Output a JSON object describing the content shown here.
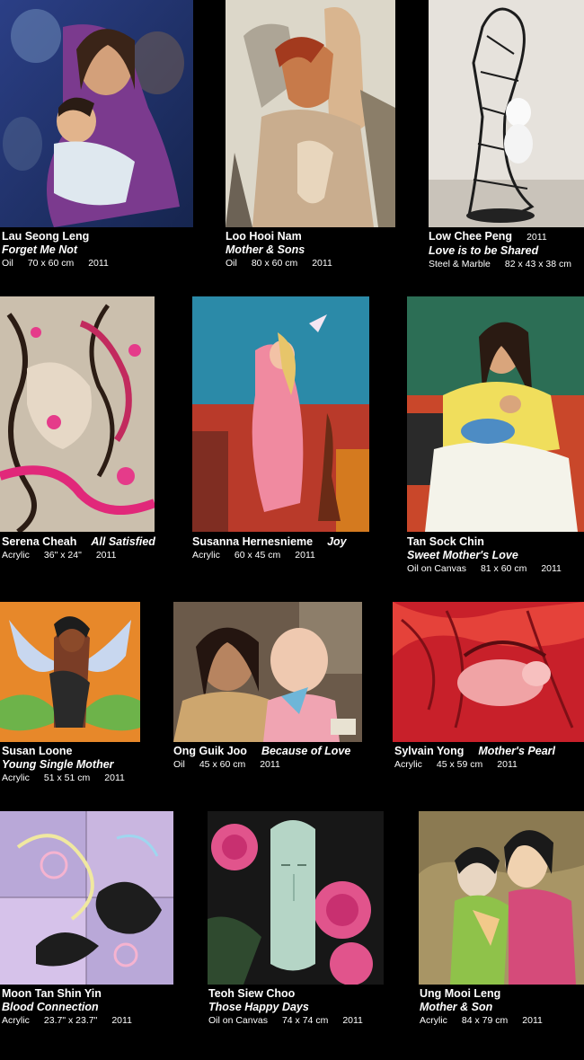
{
  "artworks": [
    {
      "artist": "Lau Seong Leng",
      "title": "Forget Me Not",
      "medium": "Oil",
      "size": "70 x 60 cm",
      "year": "2011"
    },
    {
      "artist": "Loo Hooi Nam",
      "title": "Mother & Sons",
      "medium": "Oil",
      "size": "80 x 60 cm",
      "year": "2011"
    },
    {
      "artist": "Low Chee Peng",
      "title": "Love is to be Shared",
      "medium": "Steel & Marble",
      "size": "82 x 43 x 38 cm",
      "year": "2011"
    },
    {
      "artist": "Serena Cheah",
      "title": "All Satisfied",
      "medium": "Acrylic",
      "size": "36\" x 24\"",
      "year": "2011"
    },
    {
      "artist": "Susanna Hernesnieme",
      "title": "Joy",
      "medium": "Acrylic",
      "size": "60 x 45 cm",
      "year": "2011"
    },
    {
      "artist": "Tan Sock Chin",
      "title": "Sweet Mother's Love",
      "medium": "Oil on Canvas",
      "size": "81 x 60 cm",
      "year": "2011"
    },
    {
      "artist": "Susan Loone",
      "title": "Young Single Mother",
      "medium": "Acrylic",
      "size": "51 x 51 cm",
      "year": "2011"
    },
    {
      "artist": "Ong Guik Joo",
      "title": "Because of Love",
      "medium": "Oil",
      "size": "45 x 60 cm",
      "year": "2011"
    },
    {
      "artist": "Sylvain Yong",
      "title": "Mother's Pearl",
      "medium": "Acrylic",
      "size": "45 x 59 cm",
      "year": "2011"
    },
    {
      "artist": "Moon Tan Shin Yin",
      "title": "Blood Connection",
      "medium": "Acrylic",
      "size": "23.7\" x 23.7\"",
      "year": "2011"
    },
    {
      "artist": "Teoh Siew Choo",
      "title": "Those Happy Days",
      "medium": "Oil on Canvas",
      "size": "74 x 74 cm",
      "year": "2011"
    },
    {
      "artist": "Ung Mooi Leng",
      "title": "Mother & Son",
      "medium": "Acrylic",
      "size": "84 x 79 cm",
      "year": "2011"
    }
  ]
}
